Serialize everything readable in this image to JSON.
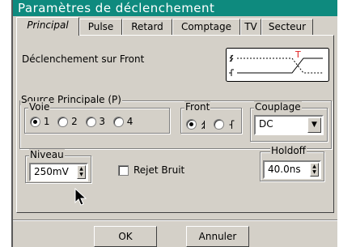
{
  "window": {
    "title": "Paramètres de déclenchement"
  },
  "tabs": [
    {
      "label": "Principal",
      "active": true
    },
    {
      "label": "Pulse"
    },
    {
      "label": "Retard"
    },
    {
      "label": "Comptage"
    },
    {
      "label": "TV"
    },
    {
      "label": "Secteur"
    }
  ],
  "main": {
    "trigger_mode": "Déclenchement sur Front",
    "preview_marker": "T",
    "source_group": {
      "legend": "Source Principale (P)",
      "voie": {
        "legend": "Voie",
        "options": [
          "1",
          "2",
          "3",
          "4"
        ],
        "selected": "1"
      },
      "front": {
        "legend": "Front",
        "options": [
          "rising-edge-icon",
          "falling-edge-icon"
        ],
        "selected": "rising-edge-icon"
      },
      "couplage": {
        "legend": "Couplage",
        "value": "DC"
      }
    },
    "niveau": {
      "legend": "Niveau",
      "value": "250mV"
    },
    "rejet_bruit": {
      "label": "Rejet Bruit",
      "checked": false
    },
    "holdoff": {
      "legend": "Holdoff",
      "value": "40.0ns"
    }
  },
  "footer": {
    "ok_label": "OK",
    "cancel_label": "Annuler"
  },
  "colors": {
    "title_bar": "#0e8a7e",
    "dialog_bg": "#d4d0c8",
    "preview_marker": "#e02020"
  }
}
